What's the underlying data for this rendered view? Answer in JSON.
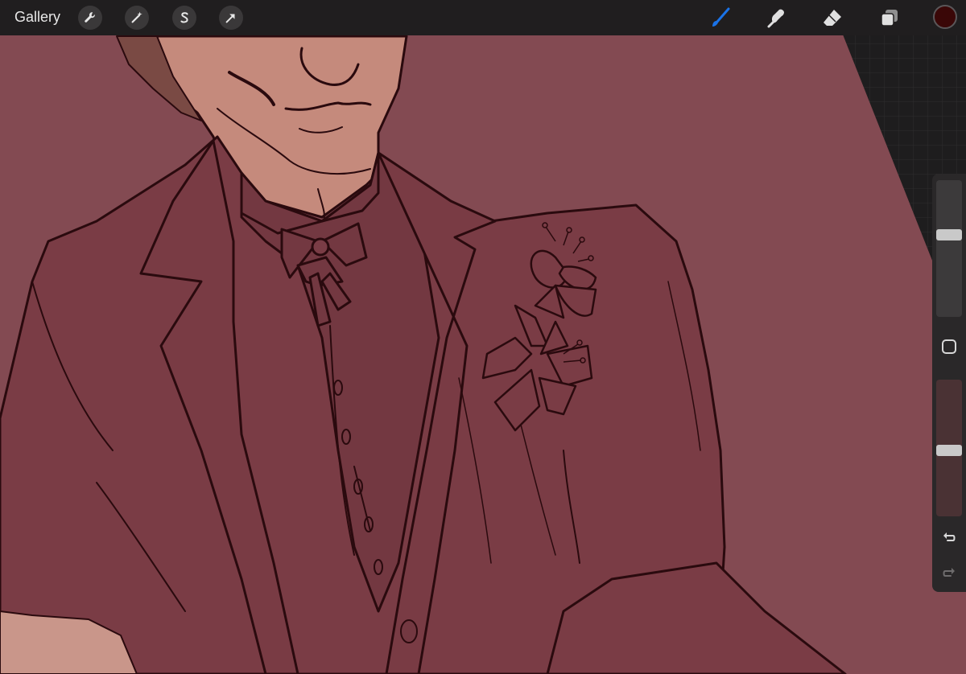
{
  "topbar": {
    "gallery_label": "Gallery",
    "left_tools": [
      "wrench-icon",
      "magic-wand-icon",
      "selection-s-icon",
      "transform-arrow-icon"
    ],
    "right_tools": [
      "brush-icon",
      "smudge-icon",
      "eraser-icon",
      "layers-icon"
    ],
    "active_tool": "brush-icon",
    "current_color": "#3a0707"
  },
  "sidebar": {
    "brush_size_level": 0.6,
    "opacity_level": 0.48,
    "buttons": [
      "modify-square-icon",
      "undo-icon",
      "redo-icon"
    ]
  },
  "colors": {
    "canvas_background": "#834a52",
    "line_art": "#2a0a0e",
    "accent_blue": "#1a73e8",
    "skin": "#c08878"
  }
}
